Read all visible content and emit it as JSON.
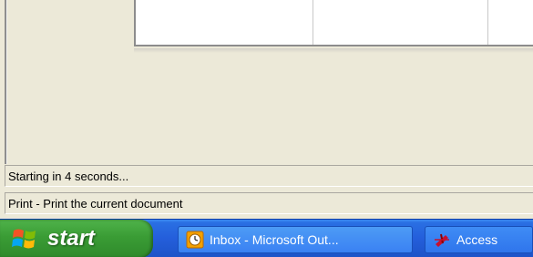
{
  "status": {
    "line1": "Starting in 4 seconds...",
    "line2": "Print - Print the current document"
  },
  "taskbar": {
    "start_label": "start",
    "tasks": [
      {
        "label": "Inbox - Microsoft Out...",
        "icon": "outlook-clock-icon"
      },
      {
        "label": "Access",
        "icon": "access-key-icon"
      }
    ]
  },
  "colors": {
    "taskbar_blue": "#245edb",
    "start_green": "#3a9c35",
    "window_face": "#ece9d8"
  }
}
